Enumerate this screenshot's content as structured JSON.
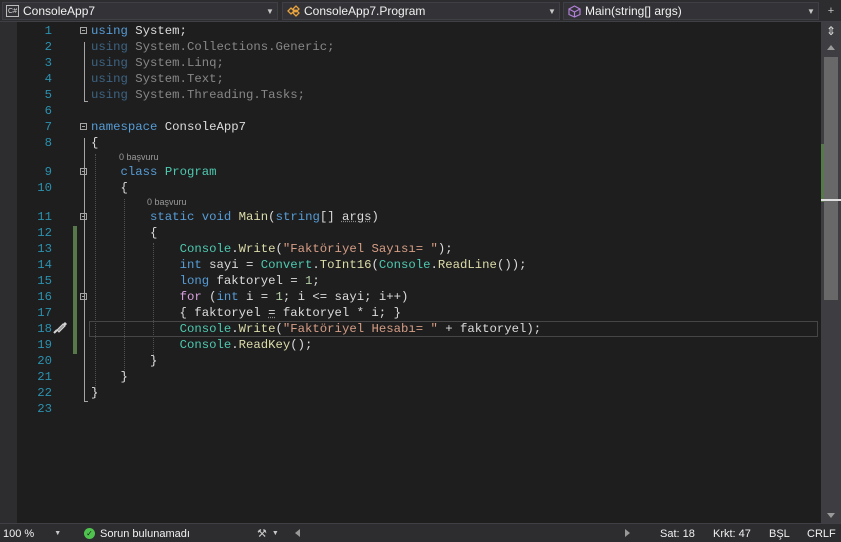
{
  "navbar": {
    "project": {
      "icon": "csharp-project-icon",
      "label": "ConsoleApp7"
    },
    "type": {
      "icon": "class-icon",
      "label": "ConsoleApp7.Program"
    },
    "member": {
      "icon": "method-icon",
      "label": "Main(string[] args)"
    }
  },
  "editor": {
    "codelens": [
      "0 başvuru",
      "0 başvuru"
    ],
    "lines": [
      {
        "n": "1",
        "tokens": [
          [
            "kw",
            "using"
          ],
          [
            "va",
            " System;"
          ]
        ]
      },
      {
        "n": "2",
        "tokens": [
          [
            "kw dim",
            "using"
          ],
          [
            "va dim",
            " System.Collections.Generic;"
          ]
        ]
      },
      {
        "n": "3",
        "tokens": [
          [
            "kw dim",
            "using"
          ],
          [
            "va dim",
            " System.Linq;"
          ]
        ]
      },
      {
        "n": "4",
        "tokens": [
          [
            "kw dim",
            "using"
          ],
          [
            "va dim",
            " System.Text;"
          ]
        ]
      },
      {
        "n": "5",
        "tokens": [
          [
            "kw dim",
            "using"
          ],
          [
            "va dim",
            " System.Threading.Tasks;"
          ]
        ]
      },
      {
        "n": "6",
        "tokens": []
      },
      {
        "n": "7",
        "tokens": [
          [
            "kw",
            "namespace"
          ],
          [
            "va",
            " ConsoleApp7"
          ]
        ]
      },
      {
        "n": "8",
        "tokens": [
          [
            "va",
            "{"
          ]
        ]
      },
      {
        "n": "9",
        "tokens": [
          [
            "va",
            "    "
          ],
          [
            "kw",
            "class"
          ],
          [
            "va",
            " "
          ],
          [
            "ty",
            "Program"
          ]
        ]
      },
      {
        "n": "10",
        "tokens": [
          [
            "va",
            "    {"
          ]
        ]
      },
      {
        "n": "11",
        "tokens": [
          [
            "va",
            "        "
          ],
          [
            "kw",
            "static"
          ],
          [
            "va",
            " "
          ],
          [
            "kw",
            "void"
          ],
          [
            "va",
            " "
          ],
          [
            "mt",
            "Main"
          ],
          [
            "va",
            "("
          ],
          [
            "kw",
            "string"
          ],
          [
            "va",
            "[] "
          ],
          [
            "va sq",
            "args"
          ],
          [
            "va",
            ")"
          ]
        ]
      },
      {
        "n": "12",
        "tokens": [
          [
            "va",
            "        {"
          ]
        ]
      },
      {
        "n": "13",
        "tokens": [
          [
            "va",
            "            "
          ],
          [
            "ty",
            "Console"
          ],
          [
            "va",
            "."
          ],
          [
            "mt",
            "Write"
          ],
          [
            "va",
            "("
          ],
          [
            "st",
            "\"Faktöriyel Sayısı= \""
          ],
          [
            "va",
            ");"
          ]
        ]
      },
      {
        "n": "14",
        "tokens": [
          [
            "va",
            "            "
          ],
          [
            "kw",
            "int"
          ],
          [
            "va",
            " sayi = "
          ],
          [
            "ty",
            "Convert"
          ],
          [
            "va",
            "."
          ],
          [
            "mt",
            "ToInt16"
          ],
          [
            "va",
            "("
          ],
          [
            "ty",
            "Console"
          ],
          [
            "va",
            "."
          ],
          [
            "mt",
            "ReadLine"
          ],
          [
            "va",
            "());"
          ]
        ]
      },
      {
        "n": "15",
        "tokens": [
          [
            "va",
            "            "
          ],
          [
            "kw",
            "long"
          ],
          [
            "va",
            " faktoryel = "
          ],
          [
            "nm",
            "1"
          ],
          [
            "va",
            ";"
          ]
        ]
      },
      {
        "n": "16",
        "tokens": [
          [
            "va",
            "            "
          ],
          [
            "ctl",
            "for"
          ],
          [
            "va",
            " ("
          ],
          [
            "kw",
            "int"
          ],
          [
            "va",
            " i = "
          ],
          [
            "nm",
            "1"
          ],
          [
            "va",
            "; i <= sayi; i++)"
          ]
        ]
      },
      {
        "n": "17",
        "tokens": [
          [
            "va",
            "            { faktoryel "
          ],
          [
            "va sq",
            "="
          ],
          [
            "va",
            " faktoryel * i; }"
          ]
        ]
      },
      {
        "n": "18",
        "tokens": [
          [
            "va",
            "            "
          ],
          [
            "ty",
            "Console"
          ],
          [
            "va",
            "."
          ],
          [
            "mt",
            "Write"
          ],
          [
            "va",
            "("
          ],
          [
            "st",
            "\"Faktöriyel Hesabı= \""
          ],
          [
            "va",
            " + faktoryel);"
          ]
        ]
      },
      {
        "n": "19",
        "tokens": [
          [
            "va",
            "            "
          ],
          [
            "ty",
            "Console"
          ],
          [
            "va",
            "."
          ],
          [
            "mt",
            "ReadKey"
          ],
          [
            "va",
            "();"
          ]
        ]
      },
      {
        "n": "20",
        "tokens": [
          [
            "va",
            "        }"
          ]
        ]
      },
      {
        "n": "21",
        "tokens": [
          [
            "va",
            "    }"
          ]
        ]
      },
      {
        "n": "22",
        "tokens": [
          [
            "va",
            "}"
          ]
        ]
      },
      {
        "n": "23",
        "tokens": []
      }
    ]
  },
  "statusbar": {
    "zoom": "100 %",
    "issues": "Sorun bulunamadı",
    "line": "Sat: 18",
    "col": "Krkt: 47",
    "mode": "BŞL",
    "eol": "CRLF"
  }
}
